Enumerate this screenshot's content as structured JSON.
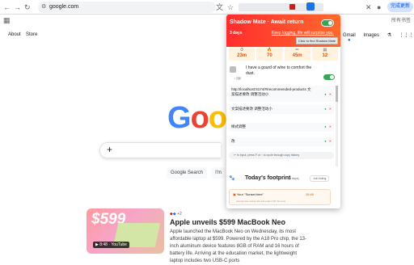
{
  "browser": {
    "url": "google.com",
    "complete_update": "完成更新",
    "bookmark_right": "所有书签",
    "bookmark_cn": "书签"
  },
  "google": {
    "nav_about": "About",
    "nav_store": "Store",
    "nav_mail": "Gmail",
    "nav_images": "Images",
    "logo_text": "Goo",
    "btn_search": "Google Search",
    "btn_lucky": "I'm"
  },
  "news": {
    "price_tag": "$599",
    "video_badge": "▶ 8:48 · YouTube",
    "source_plus": "+2",
    "title": "Apple unveils $599 MacBook Neo",
    "body": "Apple launched the MacBook Neo on Wednesday, its most affordable laptop at $599. Powered by the A18 Pro chip, the 13-inch aluminum device features 8GB of RAM and 16 hours of battery life. Arriving at the education market, the lightweight laptop includes two USB-C ports"
  },
  "popup": {
    "title": "Shadow Mate · Await return",
    "days": "3 days",
    "warning": "Keep logging, life will surprise you.",
    "tooltip": "Click to find Shadow Mate",
    "stats": [
      {
        "icon": "⏱",
        "value": "23m"
      },
      {
        "icon": "🔥",
        "value": "70"
      },
      {
        "icon": "✏",
        "value": "45m"
      },
      {
        "icon": "▤",
        "value": "12"
      }
    ],
    "quote_label": "• 沉默",
    "quote": "I have a gourd of wine to comfort the dust.",
    "history": [
      "http://localhost:5174/#/recommended-products 文案描述要改 调整活动小",
      "文案描述要改 调整活动小",
      "样式调整",
      "改"
    ],
    "hint": "↩ In input, press F or ↑ to cycle through copy history",
    "footprint_title": "Today's footprint",
    "footprint_date": "(3 days)",
    "footprint_btn": "Join listing",
    "footprint_item": "Your \"Sunset time\"",
    "footprint_time": "15:40",
    "footprint_sub": "Sunset hour starts 3/4 and ends 6:00 this time"
  }
}
